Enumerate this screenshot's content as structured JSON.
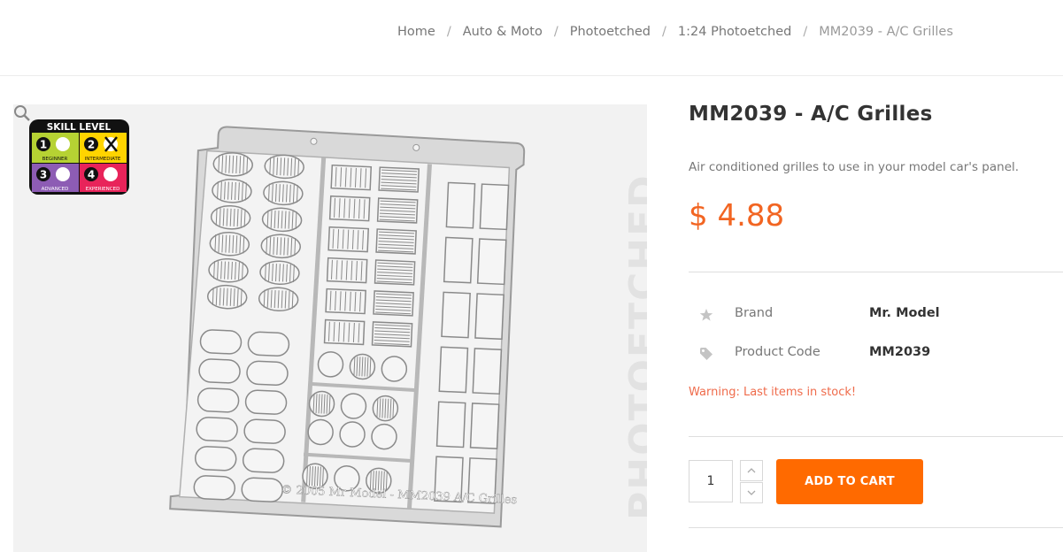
{
  "breadcrumb": {
    "items": [
      "Home",
      "Auto & Moto",
      "Photoetched",
      "1:24 Photoetched",
      "MM2039 - A/C Grilles"
    ]
  },
  "product": {
    "title": "MM2039 - A/C Grilles",
    "description": "Air conditioned grilles to use in your model car's panel.",
    "price": "$ 4.88",
    "attributes": [
      {
        "icon": "star-icon",
        "label": "Brand",
        "value": "Mr. Model"
      },
      {
        "icon": "tag-icon",
        "label": "Product Code",
        "value": "MM2039"
      }
    ],
    "stock_warning": "Warning: Last items in stock!"
  },
  "image": {
    "skill_badge": {
      "title": "SKILL LEVEL",
      "levels": [
        "BEGINNER",
        "INTERMEDIATE",
        "ADVANCED",
        "EXPERIENCED"
      ],
      "level_numbers": [
        "1",
        "2",
        "3",
        "4"
      ],
      "level_colors": [
        "#b6d233",
        "#ffd400",
        "#8d5cb4",
        "#e8245a"
      ],
      "selected_level": 2
    },
    "fret_caption": "© 2005 Mr Model - MM2039 A/C Grilles",
    "watermark": "PHOTOETCHED"
  },
  "cart": {
    "quantity": "1",
    "add_label": "ADD TO CART"
  },
  "colors": {
    "accent": "#ff6a00",
    "price": "#f26522",
    "warning": "#ef6b4b"
  }
}
